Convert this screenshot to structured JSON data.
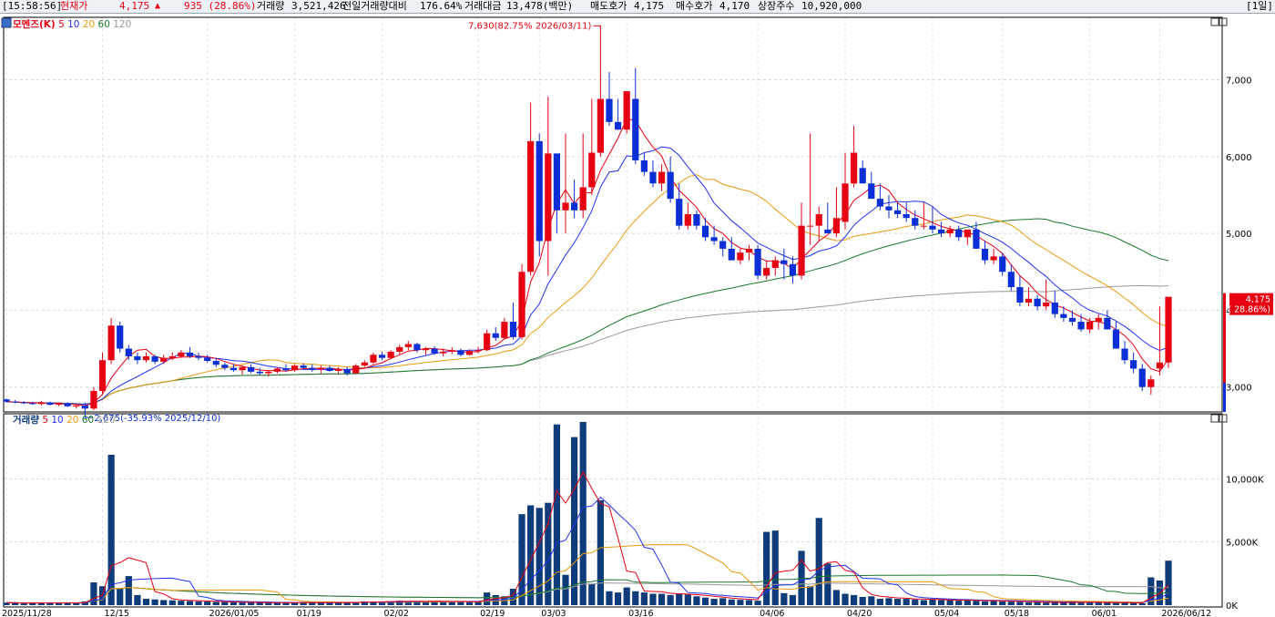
{
  "infobar": {
    "time": "[15:58:56]",
    "price_label": "현재가",
    "price": "4,175",
    "change_arrow": "▲",
    "change": "935 (28.86%)",
    "volume_label": "거래량",
    "volume": "3,521,426",
    "vs_prev_label": "전일거래량대비",
    "vs_prev": "176.64%",
    "amount_label": "거래대금",
    "amount": "13,478(백만)",
    "ask_label": "매도호가",
    "ask": "4,175",
    "bid_label": "매수호가",
    "bid": "4,170",
    "shares_label": "상장주수",
    "shares": "10,920,000",
    "period": "[1일]"
  },
  "price_legend": {
    "name": "모멘즈(K)",
    "ma5": "5",
    "ma10": "10",
    "ma20": "20",
    "ma60": "60",
    "ma120": "120"
  },
  "volume_legend": {
    "name": "거래량",
    "ma5": "5",
    "ma10": "10",
    "ma20": "20",
    "ma60": "60",
    "ma120": "120"
  },
  "annotations": {
    "high": "7,630(82.75% 2026/03/11)",
    "low": "2,675(-35.93% 2025/12/10)",
    "last_price": "4,175",
    "last_change": "( 28.86%)"
  },
  "colors": {
    "up": "#e60012",
    "down": "#0b2fd6",
    "ma5": "#e60012",
    "ma10": "#2233ee",
    "ma20": "#e89a10",
    "ma60": "#1a7a2a",
    "ma120": "#9a9a9a",
    "volume": "#0e3c7a"
  },
  "chart_data": {
    "type": "candlestick",
    "ylim": [
      2700,
      7800
    ],
    "y_ticks": [
      3000,
      4000,
      5000,
      6000,
      7000
    ],
    "y_tick_labels": [
      "3,000",
      "4,000",
      "5,000",
      "6,000",
      "7,000"
    ],
    "volume_ylim": [
      0,
      15000
    ],
    "volume_ticks": [
      0,
      5000,
      10000
    ],
    "volume_tick_labels": [
      "0K",
      "5,000K",
      "10,000K"
    ],
    "x_tick_labels": [
      {
        "i": 0,
        "label": "2025/11/28"
      },
      {
        "i": 11,
        "label": "12/15"
      },
      {
        "i": 23,
        "label": "2026/01/05"
      },
      {
        "i": 33,
        "label": "01/19"
      },
      {
        "i": 43,
        "label": "02/02"
      },
      {
        "i": 54,
        "label": "02/19"
      },
      {
        "i": 61,
        "label": "03/03"
      },
      {
        "i": 71,
        "label": "03/16"
      },
      {
        "i": 86,
        "label": "04/06"
      },
      {
        "i": 96,
        "label": "04/20"
      },
      {
        "i": 106,
        "label": "05/04"
      },
      {
        "i": 114,
        "label": "05/18"
      },
      {
        "i": 124,
        "label": "06/01"
      },
      {
        "i": 132,
        "label": "2026/06/12"
      }
    ],
    "candles": [
      [
        2840,
        2850,
        2800,
        2810
      ],
      [
        2810,
        2830,
        2790,
        2800
      ],
      [
        2800,
        2820,
        2780,
        2790
      ],
      [
        2790,
        2810,
        2770,
        2780
      ],
      [
        2780,
        2820,
        2760,
        2800
      ],
      [
        2800,
        2810,
        2760,
        2770
      ],
      [
        2770,
        2800,
        2750,
        2790
      ],
      [
        2790,
        2800,
        2740,
        2750
      ],
      [
        2750,
        2770,
        2720,
        2760
      ],
      [
        2760,
        2800,
        2675,
        2720
      ],
      [
        2720,
        3000,
        2700,
        2950
      ],
      [
        2950,
        3450,
        2900,
        3350
      ],
      [
        3350,
        3900,
        3300,
        3800
      ],
      [
        3800,
        3850,
        3450,
        3500
      ],
      [
        3500,
        3550,
        3350,
        3400
      ],
      [
        3400,
        3450,
        3300,
        3350
      ],
      [
        3350,
        3450,
        3320,
        3400
      ],
      [
        3400,
        3420,
        3300,
        3330
      ],
      [
        3330,
        3420,
        3300,
        3380
      ],
      [
        3380,
        3450,
        3350,
        3400
      ],
      [
        3400,
        3480,
        3380,
        3450
      ],
      [
        3450,
        3520,
        3380,
        3400
      ],
      [
        3400,
        3450,
        3350,
        3380
      ],
      [
        3380,
        3420,
        3320,
        3340
      ],
      [
        3340,
        3380,
        3260,
        3290
      ],
      [
        3290,
        3320,
        3220,
        3250
      ],
      [
        3250,
        3300,
        3200,
        3220
      ],
      [
        3220,
        3280,
        3160,
        3260
      ],
      [
        3260,
        3300,
        3180,
        3200
      ],
      [
        3200,
        3250,
        3150,
        3180
      ],
      [
        3180,
        3220,
        3140,
        3200
      ],
      [
        3200,
        3260,
        3180,
        3240
      ],
      [
        3240,
        3300,
        3200,
        3220
      ],
      [
        3220,
        3300,
        3200,
        3280
      ],
      [
        3280,
        3310,
        3220,
        3250
      ],
      [
        3250,
        3300,
        3200,
        3230
      ],
      [
        3230,
        3280,
        3180,
        3250
      ],
      [
        3250,
        3280,
        3200,
        3210
      ],
      [
        3210,
        3260,
        3180,
        3230
      ],
      [
        3230,
        3260,
        3150,
        3180
      ],
      [
        3180,
        3300,
        3170,
        3280
      ],
      [
        3280,
        3350,
        3260,
        3320
      ],
      [
        3320,
        3450,
        3300,
        3420
      ],
      [
        3420,
        3460,
        3350,
        3380
      ],
      [
        3380,
        3480,
        3360,
        3460
      ],
      [
        3460,
        3550,
        3430,
        3520
      ],
      [
        3520,
        3600,
        3480,
        3560
      ],
      [
        3560,
        3580,
        3450,
        3480
      ],
      [
        3480,
        3520,
        3420,
        3500
      ],
      [
        3500,
        3530,
        3420,
        3440
      ],
      [
        3440,
        3500,
        3400,
        3460
      ],
      [
        3460,
        3520,
        3430,
        3480
      ],
      [
        3480,
        3500,
        3400,
        3420
      ],
      [
        3420,
        3490,
        3410,
        3470
      ],
      [
        3470,
        3520,
        3440,
        3480
      ],
      [
        3480,
        3750,
        3470,
        3700
      ],
      [
        3700,
        3780,
        3600,
        3640
      ],
      [
        3640,
        3900,
        3620,
        3850
      ],
      [
        3850,
        4100,
        3620,
        3650
      ],
      [
        3650,
        4600,
        3620,
        4500
      ],
      [
        4500,
        6700,
        4450,
        6200
      ],
      [
        6200,
        6300,
        4700,
        4900
      ],
      [
        4900,
        6780,
        4450,
        6040
      ],
      [
        6040,
        6000,
        5000,
        5300
      ],
      [
        5300,
        6300,
        5000,
        5400
      ],
      [
        5400,
        5700,
        5200,
        5300
      ],
      [
        5300,
        6300,
        5200,
        5600
      ],
      [
        5600,
        6750,
        5500,
        6050
      ],
      [
        6050,
        7630,
        6000,
        6750
      ],
      [
        6750,
        7100,
        6400,
        6450
      ],
      [
        6450,
        6750,
        6350,
        6350
      ],
      [
        6350,
        6850,
        6300,
        6850
      ],
      [
        6750,
        7150,
        5900,
        5950
      ],
      [
        5950,
        6050,
        5750,
        5800
      ],
      [
        5800,
        5950,
        5600,
        5650
      ],
      [
        5650,
        5900,
        5550,
        5800
      ],
      [
        5800,
        6000,
        5400,
        5450
      ],
      [
        5450,
        5650,
        5050,
        5100
      ],
      [
        5100,
        5400,
        5050,
        5250
      ],
      [
        5250,
        5300,
        5050,
        5100
      ],
      [
        5100,
        5200,
        4900,
        4950
      ],
      [
        4950,
        5100,
        4850,
        4900
      ],
      [
        4900,
        4950,
        4700,
        4800
      ],
      [
        4800,
        4950,
        4650,
        4650
      ],
      [
        4650,
        4800,
        4600,
        4750
      ],
      [
        4750,
        4850,
        4650,
        4800
      ],
      [
        4800,
        4850,
        4400,
        4450
      ],
      [
        4450,
        4650,
        4400,
        4550
      ],
      [
        4550,
        4700,
        4450,
        4650
      ],
      [
        4650,
        4800,
        4400,
        4600
      ],
      [
        4600,
        4700,
        4350,
        4450
      ],
      [
        4450,
        5400,
        4400,
        5100
      ],
      [
        5100,
        6300,
        4850,
        5100
      ],
      [
        5100,
        5350,
        4900,
        5250
      ],
      [
        5050,
        5400,
        5000,
        5000
      ],
      [
        5000,
        5600,
        4950,
        5200
      ],
      [
        5150,
        6050,
        5050,
        5650
      ],
      [
        5650,
        6400,
        5600,
        6050
      ],
      [
        5850,
        5950,
        5650,
        5650
      ],
      [
        5650,
        5800,
        5450,
        5450
      ],
      [
        5450,
        5650,
        5300,
        5350
      ],
      [
        5350,
        5500,
        5200,
        5300
      ],
      [
        5300,
        5400,
        5200,
        5250
      ],
      [
        5250,
        5400,
        5150,
        5200
      ],
      [
        5200,
        5300,
        5050,
        5100
      ],
      [
        5100,
        5400,
        5050,
        5100
      ],
      [
        5100,
        5350,
        5000,
        5050
      ],
      [
        5050,
        5150,
        4950,
        5000
      ],
      [
        5000,
        5100,
        4950,
        5050
      ],
      [
        5050,
        5100,
        4900,
        4950
      ],
      [
        4950,
        5050,
        4850,
        5050
      ],
      [
        5050,
        5150,
        4900,
        4800
      ],
      [
        4800,
        4900,
        4600,
        4650
      ],
      [
        4650,
        4800,
        4600,
        4700
      ],
      [
        4700,
        4750,
        4450,
        4500
      ],
      [
        4500,
        4600,
        4250,
        4300
      ],
      [
        4300,
        4450,
        4050,
        4100
      ],
      [
        4100,
        4300,
        4050,
        4150
      ],
      [
        4150,
        4200,
        4000,
        4050
      ],
      [
        4050,
        4400,
        4000,
        4100
      ],
      [
        4100,
        4250,
        3900,
        3950
      ],
      [
        3950,
        4050,
        3850,
        3900
      ],
      [
        3900,
        4000,
        3800,
        3850
      ],
      [
        3850,
        3950,
        3720,
        3750
      ],
      [
        3750,
        3900,
        3700,
        3850
      ],
      [
        3850,
        3950,
        3750,
        3900
      ],
      [
        3900,
        4000,
        3750,
        3750
      ],
      [
        3750,
        3850,
        3500,
        3500
      ],
      [
        3500,
        3600,
        3300,
        3350
      ],
      [
        3350,
        3450,
        3180,
        3240
      ],
      [
        3240,
        3300,
        2950,
        3000
      ],
      [
        3000,
        3150,
        2900,
        3100
      ],
      [
        3240,
        4050,
        3150,
        3320
      ],
      [
        3320,
        4140,
        3250,
        4175
      ]
    ],
    "volume": [
      200,
      180,
      150,
      200,
      180,
      170,
      200,
      180,
      160,
      300,
      1800,
      1500,
      11900,
      1300,
      2300,
      800,
      500,
      450,
      400,
      380,
      350,
      330,
      300,
      280,
      250,
      240,
      220,
      210,
      200,
      200,
      190,
      180,
      200,
      220,
      230,
      210,
      200,
      190,
      210,
      200,
      250,
      300,
      280,
      260,
      300,
      350,
      320,
      290,
      300,
      310,
      280,
      270,
      300,
      260,
      250,
      1000,
      800,
      700,
      1300,
      7200,
      7900,
      7700,
      8100,
      14300,
      2400,
      13300,
      14500,
      1700,
      8300,
      1100,
      1000,
      1400,
      1100,
      1000,
      900,
      900,
      800,
      900,
      850,
      700,
      600,
      500,
      550,
      450,
      420,
      400,
      350,
      5800,
      5900,
      950,
      800,
      4300,
      1500,
      6900,
      3300,
      1200,
      900,
      800,
      650,
      700,
      500,
      550,
      500,
      500,
      450,
      400,
      450,
      400,
      400,
      350,
      400,
      350,
      300,
      350,
      300,
      280,
      250,
      220,
      230,
      200,
      210,
      200,
      250,
      230,
      220,
      200,
      180,
      170,
      200,
      160,
      150,
      2200,
      1950,
      3520
    ]
  }
}
